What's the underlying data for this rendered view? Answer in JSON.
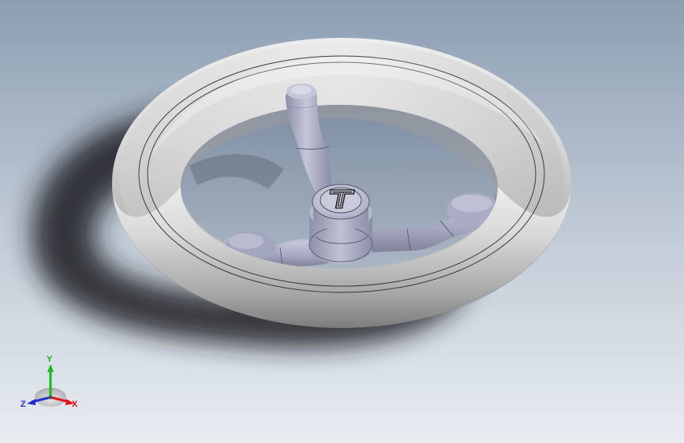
{
  "viewport": {
    "background_top": "#8fa0b4",
    "background_bottom": "#e6ebf0",
    "model": {
      "name": "handwheel",
      "hub_logo_letter": "T",
      "rim_color": "#d4d4d4",
      "spoke_color": "#a9acc4",
      "hub_color": "#b2b5ca"
    }
  },
  "triad": {
    "x_label": "X",
    "y_label": "Y",
    "z_label": "Z",
    "x_color": "#e0161e",
    "y_color": "#18b81c",
    "z_color": "#1f2fcf"
  }
}
